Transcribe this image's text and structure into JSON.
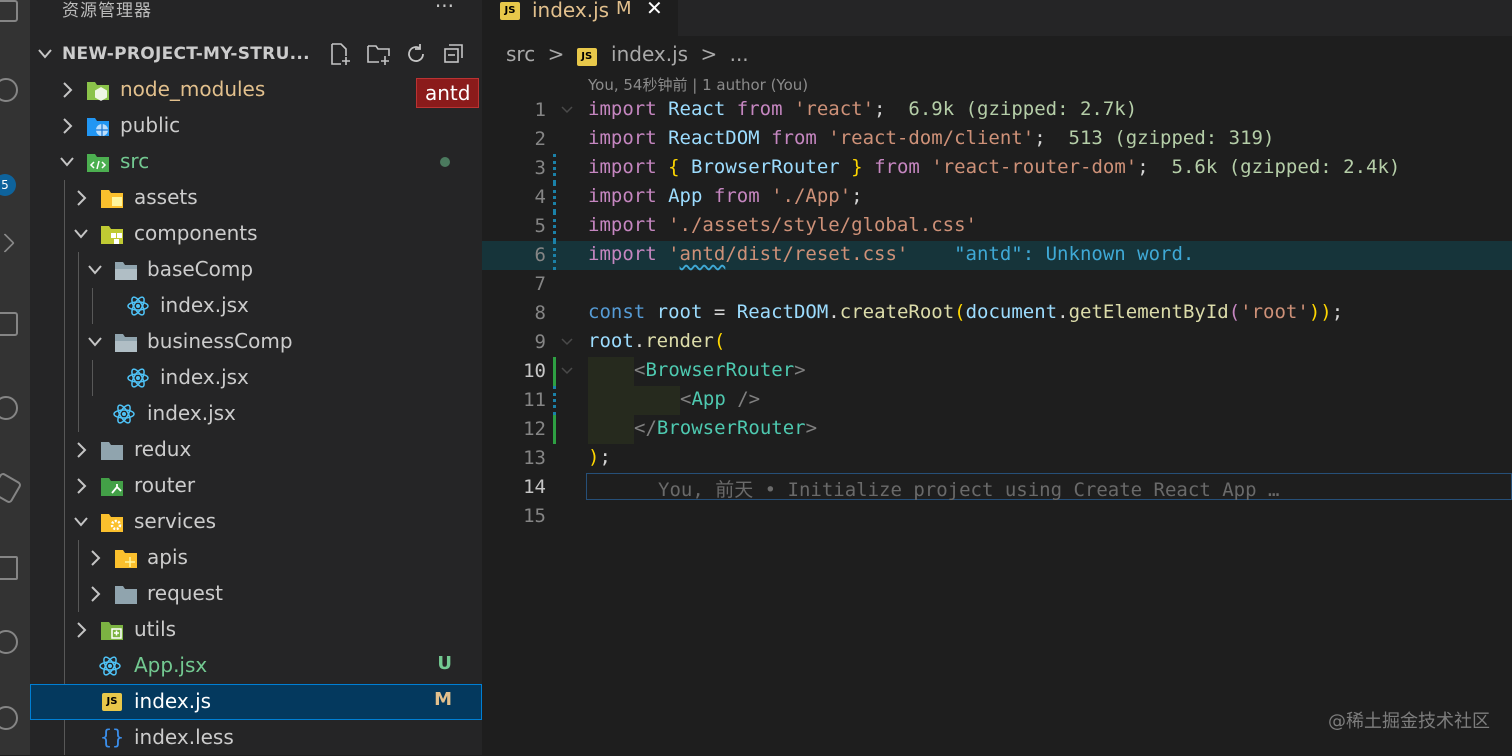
{
  "explorer": {
    "title": "资源管理器",
    "more": "···",
    "project": "NEW-PROJECT-MY-STRU...",
    "items": [
      {
        "label": "node_modules",
        "color": "#e2c08d",
        "badge": "",
        "badgeColor": ""
      },
      {
        "label": "public",
        "color": "#cccccc",
        "badge": "",
        "badgeColor": ""
      },
      {
        "label": "src",
        "color": "#73c991",
        "badge": "",
        "badgeColor": ""
      },
      {
        "label": "assets",
        "color": "#cccccc",
        "badge": "",
        "badgeColor": ""
      },
      {
        "label": "components",
        "color": "#cccccc",
        "badge": "",
        "badgeColor": ""
      },
      {
        "label": "baseComp",
        "color": "#cccccc",
        "badge": "",
        "badgeColor": ""
      },
      {
        "label": "index.jsx",
        "color": "#cccccc",
        "badge": "",
        "badgeColor": ""
      },
      {
        "label": "businessComp",
        "color": "#cccccc",
        "badge": "",
        "badgeColor": ""
      },
      {
        "label": "index.jsx",
        "color": "#cccccc",
        "badge": "",
        "badgeColor": ""
      },
      {
        "label": "index.jsx",
        "color": "#cccccc",
        "badge": "",
        "badgeColor": ""
      },
      {
        "label": "redux",
        "color": "#cccccc",
        "badge": "",
        "badgeColor": ""
      },
      {
        "label": "router",
        "color": "#cccccc",
        "badge": "",
        "badgeColor": ""
      },
      {
        "label": "services",
        "color": "#cccccc",
        "badge": "",
        "badgeColor": ""
      },
      {
        "label": "apis",
        "color": "#cccccc",
        "badge": "",
        "badgeColor": ""
      },
      {
        "label": "request",
        "color": "#cccccc",
        "badge": "",
        "badgeColor": ""
      },
      {
        "label": "utils",
        "color": "#cccccc",
        "badge": "",
        "badgeColor": ""
      },
      {
        "label": "App.jsx",
        "color": "#73c991",
        "badge": "U",
        "badgeColor": "#73c991"
      },
      {
        "label": "index.js",
        "color": "#ffffff",
        "badge": "M",
        "badgeColor": "#e2c08d"
      },
      {
        "label": "index.less",
        "color": "#cccccc",
        "badge": "",
        "badgeColor": ""
      }
    ],
    "antd_tip": "antd"
  },
  "activity": {
    "badge": "5"
  },
  "editor": {
    "tab": {
      "label": "index.js",
      "modified": "M",
      "close": "✕",
      "badge": "JS"
    },
    "breadcrumb": {
      "folder": "src",
      "sep": ">",
      "file": "index.js",
      "sep2": ">",
      "more": "..."
    },
    "blame_top": "You, 54秒钟前 | 1 author (You)",
    "lines": [
      {
        "n": "1"
      },
      {
        "n": "2"
      },
      {
        "n": "3"
      },
      {
        "n": "4"
      },
      {
        "n": "5"
      },
      {
        "n": "6"
      },
      {
        "n": "7"
      },
      {
        "n": "8"
      },
      {
        "n": "9"
      },
      {
        "n": "10"
      },
      {
        "n": "11"
      },
      {
        "n": "12"
      },
      {
        "n": "13"
      },
      {
        "n": "14"
      },
      {
        "n": "15"
      }
    ],
    "code": {
      "l1": {
        "import": "import",
        "name": "React",
        "from": "from",
        "mod": "'react'",
        "semi": ";",
        "size": "6.9k (gzipped: 2.7k)"
      },
      "l2": {
        "import": "import",
        "name": "ReactDOM",
        "from": "from",
        "mod": "'react-dom/client'",
        "semi": ";",
        "size": "513 (gzipped: 319)"
      },
      "l3": {
        "import": "import",
        "open": "{",
        "name": "BrowserRouter",
        "close": "}",
        "from": "from",
        "mod": "'react-router-dom'",
        "semi": ";",
        "size": "5.6k (gzipped: 2.4k)"
      },
      "l4": {
        "import": "import",
        "name": "App",
        "from": "from",
        "mod": "'./App'",
        "semi": ";"
      },
      "l5": {
        "import": "import",
        "mod": "'./assets/style/global.css'"
      },
      "l6": {
        "import": "import",
        "q": "'",
        "word": "antd",
        "rest": "/dist/reset.css'",
        "diag": "\"antd\": Unknown word."
      },
      "l8": {
        "const": "const",
        "root": "root",
        "eq": "=",
        "obj": "ReactDOM",
        "dot": ".",
        "fn": "createRoot",
        "p1": "(",
        "doc": "document",
        "dot2": ".",
        "fn2": "getElementById",
        "p2": "(",
        "str": "'root'",
        "p3": "))",
        "semi": ";"
      },
      "l9": {
        "root": "root",
        "dot": ".",
        "fn": "render",
        "p": "("
      },
      "l10": {
        "lt": "<",
        "tag": "BrowserRouter",
        "gt": ">"
      },
      "l11": {
        "lt": "<",
        "tag": "App",
        "end": " />"
      },
      "l12": {
        "lt": "</",
        "tag": "BrowserRouter",
        "gt": ">"
      },
      "l13": {
        "p": ")",
        "semi": ";"
      },
      "l14": {
        "blame": "You, 前天 • Initialize project using Create React App …"
      }
    }
  },
  "watermark": "@稀土掘金技术社区"
}
